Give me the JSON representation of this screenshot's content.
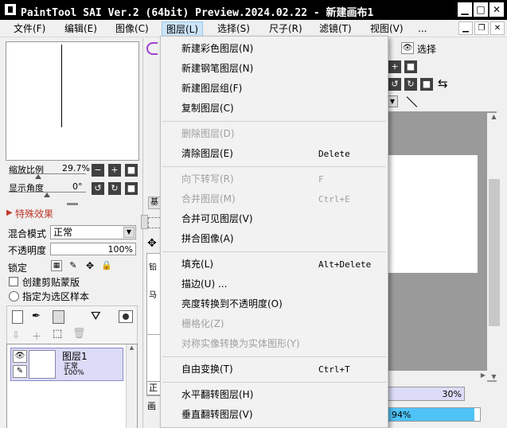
{
  "window": {
    "title": "PaintTool SAI Ver.2 (64bit) Preview.2024.02.22 - 新建画布1",
    "minimize": "▁",
    "maximize": "□",
    "close": "✕"
  },
  "menubar": {
    "items": [
      "文件(F)",
      "编辑(E)",
      "图像(C)",
      "图层(L)",
      "选择(S)",
      "尺子(R)",
      "滤镜(T)",
      "视图(V)",
      "..."
    ],
    "open_item": "图层(L)"
  },
  "navigator": {
    "zoom_label": "缩放比例",
    "zoom_value": "29.7%",
    "angle_label": "显示角度",
    "angle_value": "0°"
  },
  "layer_props": {
    "special_effects": "特殊效果",
    "blend_label": "混合模式",
    "blend_value": "正常",
    "opacity_label": "不透明度",
    "opacity_value": "100%",
    "lock_label": "锁定",
    "clip_label": "创建剪贴蒙版",
    "selection_source_label": "指定为选区样本"
  },
  "layer": {
    "name": "图层1",
    "mode": "正常",
    "opacity": "100%"
  },
  "partial_left": {
    "tab1": "基",
    "text1": "铅",
    "text2": "马",
    "text3": "正",
    "text4": "画"
  },
  "toolpanel": {
    "selection_label": "选择"
  },
  "status": {
    "zoom": "30%",
    "percent": "94%",
    "percent_fraction": 0.94
  },
  "dropdown": {
    "items": [
      {
        "label": "新建彩色图层(N)",
        "shortcut": "",
        "disabled": false
      },
      {
        "label": "新建钢笔图层(N)",
        "shortcut": "",
        "disabled": false
      },
      {
        "label": "新建图层组(F)",
        "shortcut": "",
        "disabled": false
      },
      {
        "label": "复制图层(C)",
        "shortcut": "",
        "disabled": false
      },
      {
        "sep": true
      },
      {
        "label": "删除图层(D)",
        "shortcut": "",
        "disabled": true
      },
      {
        "label": "清除图层(E)",
        "shortcut": "Delete",
        "disabled": false
      },
      {
        "sep": true
      },
      {
        "label": "向下转写(R)",
        "shortcut": "F",
        "disabled": true
      },
      {
        "label": "合并图层(M)",
        "shortcut": "Ctrl+E",
        "disabled": true
      },
      {
        "label": "合并可见图层(V)",
        "shortcut": "",
        "disabled": false
      },
      {
        "label": "拼合图像(A)",
        "shortcut": "",
        "disabled": false
      },
      {
        "sep": true
      },
      {
        "label": "填充(L)",
        "shortcut": "Alt+Delete",
        "disabled": false
      },
      {
        "label": "描边(U) ...",
        "shortcut": "",
        "disabled": false
      },
      {
        "label": "亮度转换到不透明度(O)",
        "shortcut": "",
        "disabled": false
      },
      {
        "label": "栅格化(Z)",
        "shortcut": "",
        "disabled": true
      },
      {
        "label": "对称实像转换为实体图形(Y)",
        "shortcut": "",
        "disabled": true
      },
      {
        "sep": true
      },
      {
        "label": "自由变换(T)",
        "shortcut": "Ctrl+T",
        "disabled": false
      },
      {
        "sep": true
      },
      {
        "label": "水平翻转图层(H)",
        "shortcut": "",
        "disabled": false
      },
      {
        "label": "垂直翻转图层(V)",
        "shortcut": "",
        "disabled": false
      }
    ]
  }
}
